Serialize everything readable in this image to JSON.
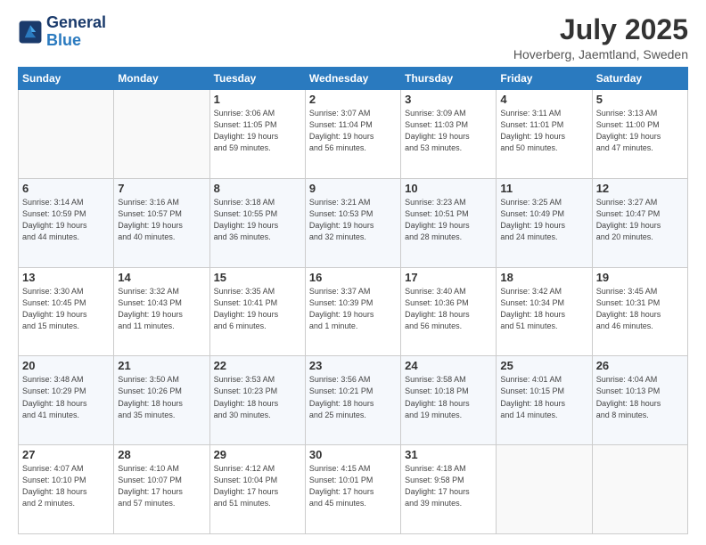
{
  "logo": {
    "line1": "General",
    "line2": "Blue"
  },
  "title": "July 2025",
  "location": "Hoverberg, Jaemtland, Sweden",
  "days_of_week": [
    "Sunday",
    "Monday",
    "Tuesday",
    "Wednesday",
    "Thursday",
    "Friday",
    "Saturday"
  ],
  "weeks": [
    [
      {
        "day": "",
        "info": ""
      },
      {
        "day": "",
        "info": ""
      },
      {
        "day": "1",
        "info": "Sunrise: 3:06 AM\nSunset: 11:05 PM\nDaylight: 19 hours\nand 59 minutes."
      },
      {
        "day": "2",
        "info": "Sunrise: 3:07 AM\nSunset: 11:04 PM\nDaylight: 19 hours\nand 56 minutes."
      },
      {
        "day": "3",
        "info": "Sunrise: 3:09 AM\nSunset: 11:03 PM\nDaylight: 19 hours\nand 53 minutes."
      },
      {
        "day": "4",
        "info": "Sunrise: 3:11 AM\nSunset: 11:01 PM\nDaylight: 19 hours\nand 50 minutes."
      },
      {
        "day": "5",
        "info": "Sunrise: 3:13 AM\nSunset: 11:00 PM\nDaylight: 19 hours\nand 47 minutes."
      }
    ],
    [
      {
        "day": "6",
        "info": "Sunrise: 3:14 AM\nSunset: 10:59 PM\nDaylight: 19 hours\nand 44 minutes."
      },
      {
        "day": "7",
        "info": "Sunrise: 3:16 AM\nSunset: 10:57 PM\nDaylight: 19 hours\nand 40 minutes."
      },
      {
        "day": "8",
        "info": "Sunrise: 3:18 AM\nSunset: 10:55 PM\nDaylight: 19 hours\nand 36 minutes."
      },
      {
        "day": "9",
        "info": "Sunrise: 3:21 AM\nSunset: 10:53 PM\nDaylight: 19 hours\nand 32 minutes."
      },
      {
        "day": "10",
        "info": "Sunrise: 3:23 AM\nSunset: 10:51 PM\nDaylight: 19 hours\nand 28 minutes."
      },
      {
        "day": "11",
        "info": "Sunrise: 3:25 AM\nSunset: 10:49 PM\nDaylight: 19 hours\nand 24 minutes."
      },
      {
        "day": "12",
        "info": "Sunrise: 3:27 AM\nSunset: 10:47 PM\nDaylight: 19 hours\nand 20 minutes."
      }
    ],
    [
      {
        "day": "13",
        "info": "Sunrise: 3:30 AM\nSunset: 10:45 PM\nDaylight: 19 hours\nand 15 minutes."
      },
      {
        "day": "14",
        "info": "Sunrise: 3:32 AM\nSunset: 10:43 PM\nDaylight: 19 hours\nand 11 minutes."
      },
      {
        "day": "15",
        "info": "Sunrise: 3:35 AM\nSunset: 10:41 PM\nDaylight: 19 hours\nand 6 minutes."
      },
      {
        "day": "16",
        "info": "Sunrise: 3:37 AM\nSunset: 10:39 PM\nDaylight: 19 hours\nand 1 minute."
      },
      {
        "day": "17",
        "info": "Sunrise: 3:40 AM\nSunset: 10:36 PM\nDaylight: 18 hours\nand 56 minutes."
      },
      {
        "day": "18",
        "info": "Sunrise: 3:42 AM\nSunset: 10:34 PM\nDaylight: 18 hours\nand 51 minutes."
      },
      {
        "day": "19",
        "info": "Sunrise: 3:45 AM\nSunset: 10:31 PM\nDaylight: 18 hours\nand 46 minutes."
      }
    ],
    [
      {
        "day": "20",
        "info": "Sunrise: 3:48 AM\nSunset: 10:29 PM\nDaylight: 18 hours\nand 41 minutes."
      },
      {
        "day": "21",
        "info": "Sunrise: 3:50 AM\nSunset: 10:26 PM\nDaylight: 18 hours\nand 35 minutes."
      },
      {
        "day": "22",
        "info": "Sunrise: 3:53 AM\nSunset: 10:23 PM\nDaylight: 18 hours\nand 30 minutes."
      },
      {
        "day": "23",
        "info": "Sunrise: 3:56 AM\nSunset: 10:21 PM\nDaylight: 18 hours\nand 25 minutes."
      },
      {
        "day": "24",
        "info": "Sunrise: 3:58 AM\nSunset: 10:18 PM\nDaylight: 18 hours\nand 19 minutes."
      },
      {
        "day": "25",
        "info": "Sunrise: 4:01 AM\nSunset: 10:15 PM\nDaylight: 18 hours\nand 14 minutes."
      },
      {
        "day": "26",
        "info": "Sunrise: 4:04 AM\nSunset: 10:13 PM\nDaylight: 18 hours\nand 8 minutes."
      }
    ],
    [
      {
        "day": "27",
        "info": "Sunrise: 4:07 AM\nSunset: 10:10 PM\nDaylight: 18 hours\nand 2 minutes."
      },
      {
        "day": "28",
        "info": "Sunrise: 4:10 AM\nSunset: 10:07 PM\nDaylight: 17 hours\nand 57 minutes."
      },
      {
        "day": "29",
        "info": "Sunrise: 4:12 AM\nSunset: 10:04 PM\nDaylight: 17 hours\nand 51 minutes."
      },
      {
        "day": "30",
        "info": "Sunrise: 4:15 AM\nSunset: 10:01 PM\nDaylight: 17 hours\nand 45 minutes."
      },
      {
        "day": "31",
        "info": "Sunrise: 4:18 AM\nSunset: 9:58 PM\nDaylight: 17 hours\nand 39 minutes."
      },
      {
        "day": "",
        "info": ""
      },
      {
        "day": "",
        "info": ""
      }
    ]
  ]
}
